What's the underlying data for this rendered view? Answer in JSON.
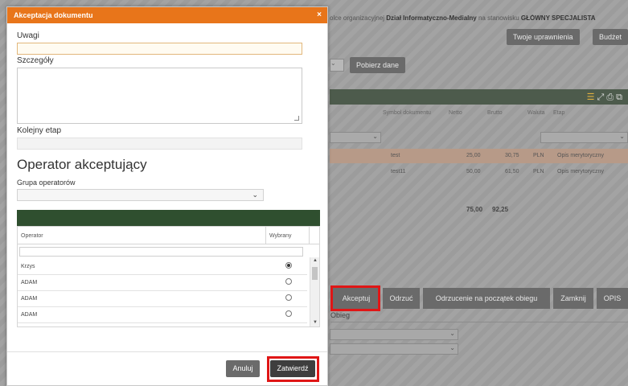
{
  "background": {
    "topline_prefix": "olce organizacyjnej",
    "topline_unit": "Dział Informatyczno-Medialny",
    "topline_mid": "na stanowisku",
    "topline_role": "GŁÓWNY SPECJALISTA",
    "btn_permissions": "Twoje uprawnienia",
    "btn_budget": "Budżet",
    "btn_fetch": "Pobierz dane",
    "columns": [
      "Symbol dokumentu",
      "Netto",
      "Brutto",
      "Waluta",
      "Etap"
    ],
    "rows": [
      {
        "symbol": "test",
        "netto": "25,00",
        "brutto": "30,75",
        "waluta": "PLN",
        "etap": "Opis merytoryczny"
      },
      {
        "symbol": "test11",
        "netto": "50,00",
        "brutto": "61,50",
        "waluta": "PLN",
        "etap": "Opis merytoryczny"
      }
    ],
    "sum_netto": "75,00",
    "sum_brutto": "92,25",
    "actions": [
      "Akceptuj",
      "Odrzuć",
      "Odrzucenie na początek obiegu",
      "Zamknij",
      "OPIS"
    ],
    "obieg_tab": "Obieg"
  },
  "modal": {
    "title": "Akceptacja dokumentu",
    "close_glyph": "×",
    "uwagi_label": "Uwagi",
    "uwagi_value": "",
    "szczegoly_label": "Szczegóły",
    "szczegoly_value": "",
    "kolejny_etap_label": "Kolejny etap",
    "kolejny_etap_value": "",
    "operator_section_title": "Operator akceptujący",
    "grupa_label": "Grupa operatorów",
    "grupa_value": "",
    "grid_columns": [
      "Operator",
      "Wybrany"
    ],
    "operators": [
      {
        "name": "Krzys",
        "selected": true
      },
      {
        "name": "ADAM",
        "selected": false
      },
      {
        "name": "ADAM",
        "selected": false
      },
      {
        "name": "ADAM",
        "selected": false
      }
    ],
    "btn_cancel": "Anuluj",
    "btn_confirm": "Zatwierdź"
  },
  "colors": {
    "modal_header": "#e8751a",
    "grid_header": "#2f4f2f",
    "highlight_frame": "#e01616"
  }
}
